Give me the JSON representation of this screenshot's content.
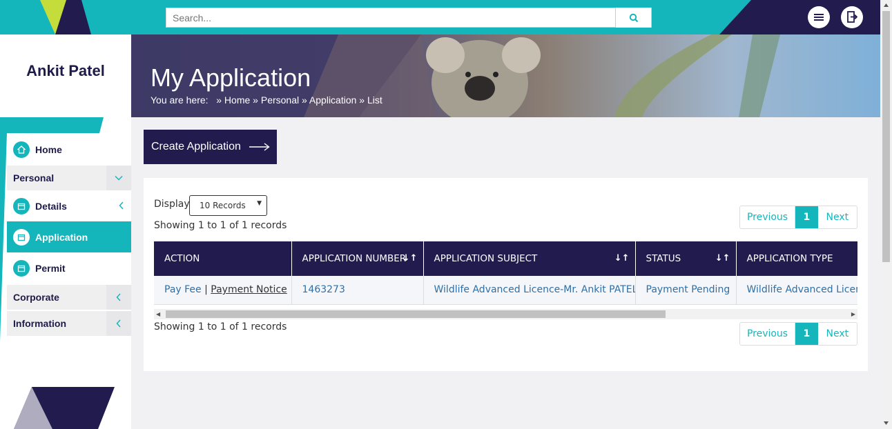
{
  "search": {
    "placeholder": "Search..."
  },
  "sidebar": {
    "user_name": "Ankit Patel",
    "items": [
      {
        "label": "Home"
      },
      {
        "label": "Personal"
      },
      {
        "label": "Details"
      },
      {
        "label": "Application"
      },
      {
        "label": "Permit"
      },
      {
        "label": "Corporate"
      },
      {
        "label": "Information"
      }
    ]
  },
  "banner": {
    "title": "My Application",
    "breadcrumb_prefix": "You are here:",
    "crumbs": [
      "Home",
      "Personal",
      "Application",
      "List"
    ]
  },
  "create_button": "Create Application",
  "display": {
    "label": "Display",
    "selected": "10 Records"
  },
  "showing": "Showing 1 to 1 of 1 records",
  "pager": {
    "previous": "Previous",
    "current": "1",
    "next": "Next"
  },
  "table": {
    "headers": [
      "ACTION",
      "APPLICATION NUMBER",
      "APPLICATION SUBJECT",
      "STATUS",
      "APPLICATION TYPE"
    ],
    "rows": [
      {
        "action_pay": "Pay Fee",
        "action_sep": "|",
        "action_notice": "Payment Notice",
        "number": "1463273",
        "subject": "Wildlife Advanced Licence-Mr. Ankit PATEL",
        "status": "Payment Pending",
        "type": "Wildlife Advanced Licence"
      }
    ]
  },
  "colors": {
    "teal": "#15b6bb",
    "navy": "#221b4d"
  }
}
